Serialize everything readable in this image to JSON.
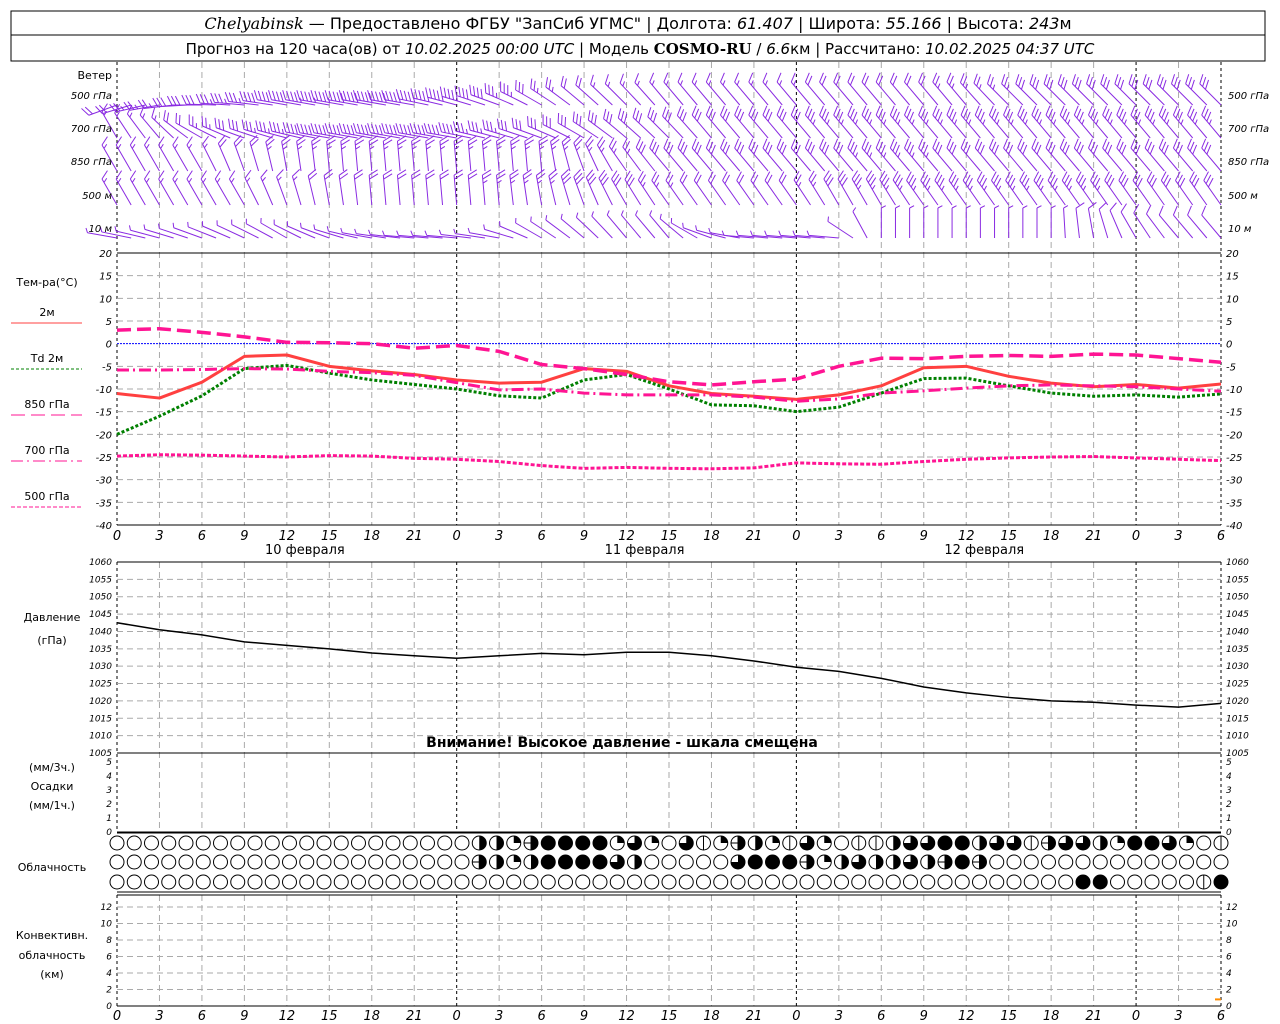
{
  "header": {
    "station": "Chelyabinsk",
    "provider": " — Предоставлено ФГБУ \"ЗапСиб УГМС\" | ",
    "lon_label": "Долгота: ",
    "lon": "61.407",
    "lat_label": " | Широта: ",
    "lat": "55.166",
    "alt_label": " | Высота: ",
    "alt": "243",
    "alt_unit": "м",
    "forecast_label": "Прогноз на 120 часа(ов) от ",
    "forecast_start": "10.02.2025 00:00 UTC",
    "model_label": "  | Модель ",
    "model": "COSMO-RU",
    "res_sep": " / ",
    "resolution": "6.6",
    "res_unit": "км",
    "computed_label": " | Рассчитано: ",
    "computed": "10.02.2025 04:37 UTC"
  },
  "wind": {
    "title": "Ветер",
    "color": "#8a2be2",
    "levels": [
      {
        "label": "500 гПа",
        "dir": [
          250,
          260,
          270,
          275,
          280,
          280,
          280,
          280,
          285,
          290,
          300,
          310,
          315,
          320,
          320,
          320,
          320,
          320,
          320,
          320,
          320,
          315,
          315,
          315,
          315,
          315,
          315
        ],
        "speed": [
          20,
          25,
          30,
          35,
          40,
          45,
          50,
          50,
          45,
          40,
          30,
          20,
          15,
          15,
          15,
          15,
          15,
          20,
          20,
          20,
          25,
          25,
          30,
          30,
          30,
          30,
          30
        ]
      },
      {
        "label": "700 гПа",
        "dir": [
          330,
          320,
          300,
          290,
          285,
          280,
          280,
          280,
          280,
          285,
          290,
          300,
          310,
          315,
          320,
          320,
          320,
          320,
          320,
          320,
          320,
          320,
          320,
          320,
          320,
          320,
          320
        ],
        "speed": [
          15,
          15,
          20,
          30,
          35,
          40,
          40,
          40,
          40,
          35,
          30,
          30,
          30,
          30,
          30,
          30,
          30,
          35,
          35,
          35,
          35,
          35,
          35,
          35,
          35,
          35,
          35
        ]
      },
      {
        "label": "850 гПа",
        "dir": [
          330,
          330,
          330,
          340,
          350,
          355,
          355,
          355,
          355,
          355,
          355,
          340,
          325,
          320,
          320,
          320,
          320,
          320,
          320,
          320,
          320,
          320,
          320,
          320,
          320,
          320,
          320
        ],
        "speed": [
          15,
          15,
          15,
          20,
          25,
          25,
          25,
          25,
          25,
          25,
          25,
          25,
          25,
          30,
          30,
          30,
          30,
          30,
          35,
          35,
          30,
          30,
          30,
          30,
          30,
          30,
          30
        ]
      },
      {
        "label": "500 м",
        "dir": [
          330,
          330,
          330,
          330,
          340,
          350,
          355,
          355,
          355,
          355,
          350,
          340,
          330,
          325,
          325,
          325,
          325,
          330,
          330,
          325,
          325,
          325,
          325,
          325,
          325,
          325,
          325
        ],
        "speed": [
          15,
          15,
          15,
          15,
          15,
          20,
          20,
          20,
          20,
          25,
          25,
          30,
          30,
          25,
          20,
          20,
          20,
          30,
          35,
          35,
          35,
          35,
          35,
          35,
          30,
          30,
          30
        ]
      },
      {
        "label": "10  м",
        "dir": [
          280,
          285,
          290,
          295,
          300,
          290,
          280,
          275,
          275,
          280,
          300,
          310,
          320,
          320,
          290,
          275,
          275,
          275,
          360,
          360,
          360,
          360,
          360,
          350,
          330,
          320,
          320
        ],
        "speed": [
          5,
          5,
          5,
          5,
          5,
          5,
          5,
          5,
          5,
          5,
          5,
          5,
          5,
          5,
          5,
          5,
          5,
          5,
          5,
          5,
          5,
          5,
          5,
          10,
          10,
          10,
          10
        ]
      }
    ]
  },
  "chart_data": [
    {
      "type": "line",
      "ylabel": "Тем-ра(°C)",
      "ylim": [
        -40,
        20
      ],
      "yticks": [
        20,
        15,
        10,
        5,
        0,
        -5,
        -10,
        -15,
        -20,
        -25,
        -30,
        -35,
        -40
      ],
      "x_hours": [
        0,
        3,
        6,
        9,
        12,
        15,
        18,
        21,
        24,
        27,
        30,
        33,
        36,
        39,
        42,
        45,
        48,
        51,
        54,
        57,
        60,
        63,
        66,
        69,
        72,
        75,
        78
      ],
      "x_tick_labels": [
        "0",
        "3",
        "6",
        "9",
        "12",
        "15",
        "18",
        "21",
        "0",
        "3",
        "6",
        "9",
        "12",
        "15",
        "18",
        "21",
        "0",
        "3",
        "6",
        "9",
        "12",
        "15",
        "18",
        "21",
        "0",
        "3",
        "6"
      ],
      "day_labels": [
        "10 февраля",
        "11 февраля",
        "12 февраля"
      ],
      "grid": true,
      "series": [
        {
          "name": "2м",
          "color": "#ff4040",
          "style": "solid",
          "values": [
            -11,
            -12,
            -8.5,
            -2.8,
            -2.5,
            -5,
            -6,
            -6.8,
            -8,
            -8.7,
            -8.5,
            -5.5,
            -6.1,
            -9.3,
            -11,
            -11.6,
            -12.3,
            -11.3,
            -9.3,
            -5.3,
            -5,
            -7.2,
            -8.7,
            -9.5,
            -9,
            -9.8,
            -8.9
          ]
        },
        {
          "name": "Td 2м",
          "color": "#008000",
          "style": "dotted",
          "values": [
            -20,
            -16,
            -11.5,
            -5.5,
            -4.8,
            -6.5,
            -8,
            -9,
            -10,
            -11.5,
            -12,
            -8,
            -6.8,
            -10,
            -13.5,
            -13.7,
            -15,
            -14,
            -10.9,
            -7.7,
            -7.6,
            -9.3,
            -10.9,
            -11.6,
            -11.3,
            -11.8,
            -11.1
          ]
        },
        {
          "name": "850 гПа",
          "color": "#ff1493",
          "style": "longdash",
          "values": [
            3,
            3.3,
            2.5,
            1.5,
            0.3,
            0.2,
            0,
            -1,
            -0.4,
            -1.7,
            -4.6,
            -5.5,
            -6.8,
            -8.4,
            -9.1,
            -8.4,
            -7.8,
            -5,
            -3.2,
            -3.3,
            -2.8,
            -2.6,
            -2.8,
            -2.3,
            -2.5,
            -3.3,
            -4.1
          ]
        },
        {
          "name": "700 гПа",
          "color": "#ff1493",
          "style": "dashdot",
          "values": [
            -5.8,
            -5.8,
            -5.7,
            -5.5,
            -5.6,
            -6.1,
            -6.4,
            -7,
            -8.6,
            -10.2,
            -10,
            -10.9,
            -11.3,
            -11.3,
            -11.3,
            -11.8,
            -12.7,
            -12.2,
            -10.9,
            -10.4,
            -9.8,
            -9.3,
            -9.1,
            -9.3,
            -9.5,
            -10,
            -10.5
          ]
        },
        {
          "name": "500 гПа",
          "color": "#ff1493",
          "style": "shortdash",
          "values": [
            -24.8,
            -24.5,
            -24.6,
            -24.8,
            -25,
            -24.7,
            -24.8,
            -25.3,
            -25.5,
            -26,
            -26.9,
            -27.5,
            -27.3,
            -27.5,
            -27.6,
            -27.4,
            -26.3,
            -26.5,
            -26.6,
            -26,
            -25.5,
            -25.2,
            -25,
            -24.9,
            -25.2,
            -25.5,
            -25.8
          ]
        }
      ],
      "zero_line_color": "#0000ff"
    },
    {
      "type": "line",
      "ylabel": "Давление",
      "yunit": "(гПа)",
      "ylim": [
        1005,
        1060
      ],
      "yticks": [
        1060,
        1055,
        1050,
        1045,
        1040,
        1035,
        1030,
        1025,
        1020,
        1015,
        1010,
        1005
      ],
      "grid": true,
      "annotation": "Внимание! Высокое давление - шкала смещена",
      "series": [
        {
          "color": "#000000",
          "values": [
            1042.5,
            1040.5,
            1039,
            1037,
            1036,
            1035,
            1033.8,
            1033,
            1032.3,
            1033,
            1033.7,
            1033.3,
            1034,
            1034,
            1033,
            1031.5,
            1029.7,
            1028.5,
            1026.5,
            1024,
            1022.3,
            1021,
            1020,
            1019.6,
            1018.8,
            1018.2,
            1019.3
          ]
        }
      ]
    },
    {
      "type": "bar",
      "ylabel": "Осадки",
      "yunit_top": "(мм/3ч.)",
      "yunit_bottom": "(мм/1ч.)",
      "ylim": [
        0,
        5
      ],
      "yticks": [
        5,
        4,
        3,
        2,
        1,
        0
      ],
      "values": []
    },
    {
      "type": "table",
      "ylabel": "Облачность",
      "note": "cloud cover symbols, 0=clear, 8=overcast",
      "rows": [
        [
          0,
          0,
          0,
          0,
          0,
          0,
          0,
          0,
          0,
          0,
          0,
          0,
          0,
          0,
          0,
          0,
          0,
          0,
          0,
          0,
          0,
          4,
          4,
          2,
          5,
          8,
          8,
          8,
          8,
          2,
          6,
          2,
          0,
          6,
          1,
          2,
          5,
          4,
          2,
          1,
          6,
          2,
          0,
          1,
          1,
          4,
          6,
          6,
          8,
          8,
          4,
          6,
          6,
          1,
          5,
          6,
          6,
          4,
          2,
          8,
          8,
          6,
          2,
          0,
          1
        ],
        [
          0,
          0,
          0,
          0,
          0,
          0,
          0,
          0,
          0,
          0,
          0,
          0,
          0,
          0,
          0,
          0,
          0,
          0,
          0,
          0,
          0,
          5,
          4,
          2,
          4,
          8,
          8,
          8,
          8,
          6,
          4,
          0,
          0,
          0,
          0,
          0,
          6,
          8,
          8,
          8,
          5,
          2,
          4,
          6,
          4,
          4,
          6,
          4,
          5,
          8,
          5,
          0,
          0,
          0,
          0,
          0,
          0,
          0,
          0,
          0,
          0,
          0,
          0,
          0,
          0
        ],
        [
          0,
          0,
          0,
          0,
          0,
          0,
          0,
          0,
          0,
          0,
          0,
          0,
          0,
          0,
          0,
          0,
          0,
          0,
          0,
          0,
          0,
          0,
          0,
          0,
          0,
          0,
          0,
          0,
          0,
          0,
          0,
          0,
          0,
          0,
          0,
          0,
          0,
          0,
          0,
          0,
          0,
          0,
          0,
          0,
          0,
          0,
          0,
          0,
          0,
          0,
          0,
          0,
          0,
          0,
          0,
          0,
          8,
          8,
          0,
          0,
          0,
          0,
          0,
          1,
          8
        ]
      ]
    },
    {
      "type": "bar",
      "ylabel_lines": [
        "Конвективн.",
        "облачность",
        "(км)"
      ],
      "ylim": [
        0,
        13
      ],
      "yticks": [
        12,
        10,
        8,
        6,
        4,
        2,
        0
      ],
      "color": "#ff8c00",
      "points": [
        {
          "hour": 78,
          "value": 0.8
        }
      ]
    }
  ]
}
